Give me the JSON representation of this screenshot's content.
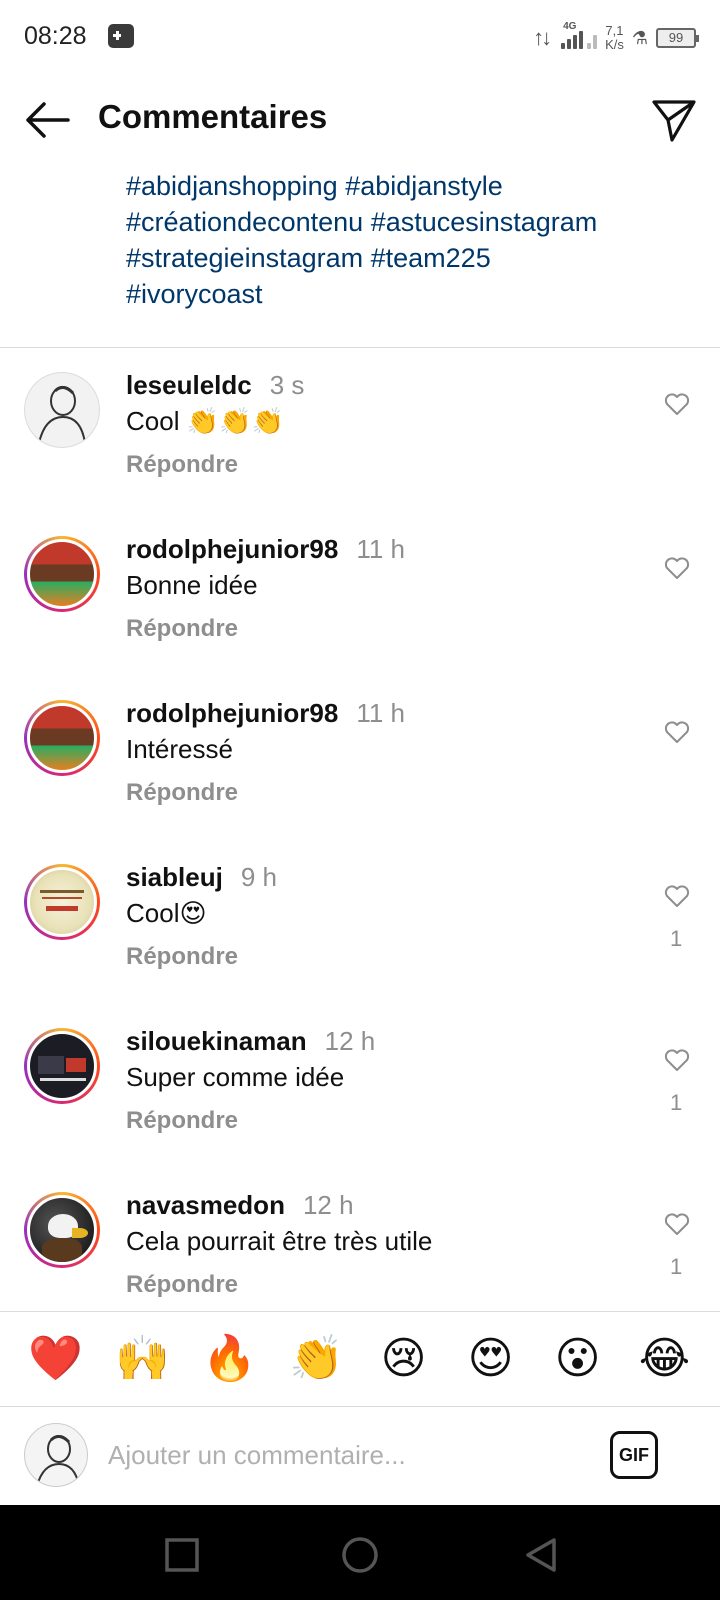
{
  "status_bar": {
    "time": "08:28",
    "network_type": "4G",
    "speed_value": "7,1",
    "speed_unit": "K/s",
    "battery": "99"
  },
  "header": {
    "title": "Commentaires",
    "back_icon": "arrow-left-icon",
    "send_icon": "paper-plane-icon"
  },
  "caption": {
    "lines": [
      "#abidjanshopping #abidjanstyle",
      "#créationdecontenu #astucesinstagram",
      "#strategieinstagram #team225",
      "#ivorycoast"
    ]
  },
  "comments": [
    {
      "username": "leseuleldc",
      "time": "3 s",
      "text": "Cool 👏👏👏",
      "reply": "Répondre",
      "likes": ""
    },
    {
      "username": "rodolphejunior98",
      "time": "11 h",
      "text": "Bonne idée",
      "reply": "Répondre",
      "likes": ""
    },
    {
      "username": "rodolphejunior98",
      "time": "11 h",
      "text": "Intéressé",
      "reply": "Répondre",
      "likes": ""
    },
    {
      "username": "siableuj",
      "time": "9 h",
      "text": "Cool😍",
      "reply": "Répondre",
      "likes": "1"
    },
    {
      "username": "silouekinaman",
      "time": "12 h",
      "text": "Super comme idée",
      "reply": "Répondre",
      "likes": "1"
    },
    {
      "username": "navasmedon",
      "time": "12 h",
      "text": "Cela pourrait être très utile",
      "reply": "Répondre",
      "likes": "1"
    }
  ],
  "emoji_bar": [
    "❤️",
    "🙌",
    "🔥",
    "👏",
    "😢",
    "😍",
    "😮",
    "😂"
  ],
  "input": {
    "placeholder": "Ajouter un commentaire...",
    "value": "",
    "gif_label": "GIF"
  },
  "colors": {
    "hashtag": "#00376b",
    "muted": "#8e8e8e",
    "divider": "#dbdbdb"
  }
}
